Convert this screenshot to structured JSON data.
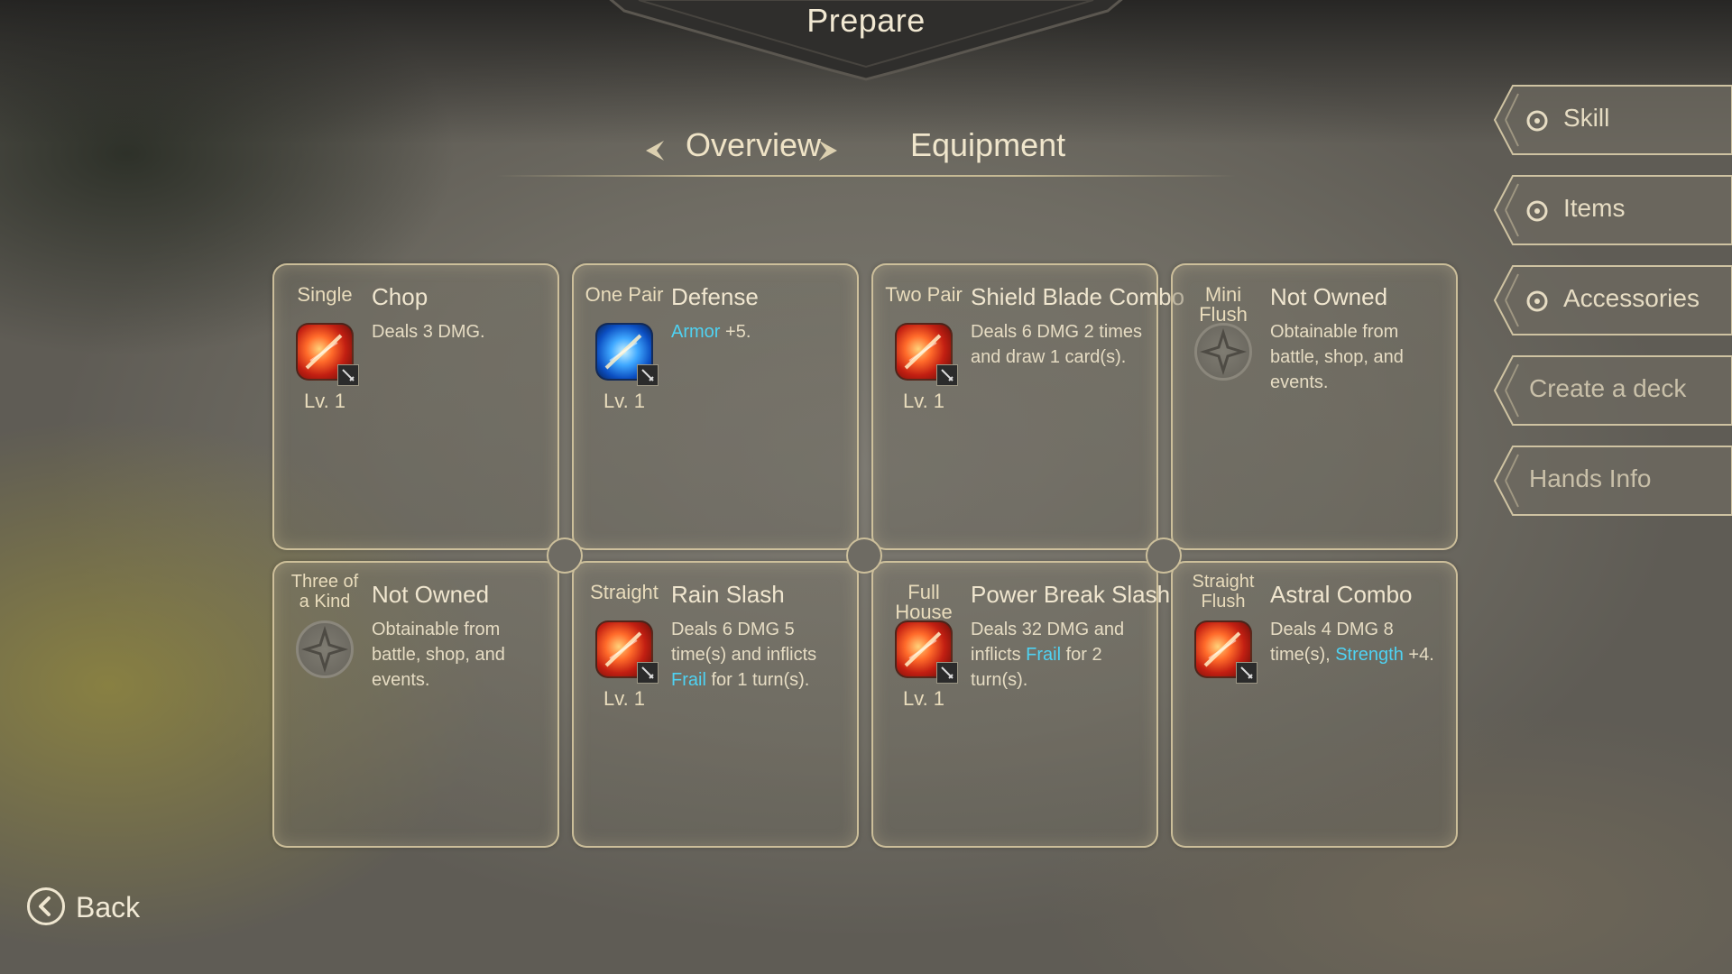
{
  "header": {
    "title": "Prepare"
  },
  "tabs": {
    "overview": "Overview",
    "equipment": "Equipment"
  },
  "cards": [
    {
      "hand": "Single",
      "name": "Chop",
      "level": "Lv. 1",
      "icon": "flame-slash-icon",
      "owned": true,
      "desc": [
        {
          "t": "Deals 3 DMG."
        }
      ]
    },
    {
      "hand": "One Pair",
      "name": "Defense",
      "level": "Lv. 1",
      "icon": "blue-shield-icon",
      "owned": true,
      "desc": [
        {
          "t": "Armor",
          "kw": true
        },
        {
          "t": " +5."
        }
      ]
    },
    {
      "hand": "Two Pair",
      "name": "Shield Blade Combo",
      "level": "Lv. 1",
      "icon": "shield-blade-icon",
      "owned": true,
      "desc": [
        {
          "t": "Deals 6 DMG 2 times and draw 1 card(s)."
        }
      ]
    },
    {
      "hand": "Mini Flush",
      "name": "Not Owned",
      "level": "",
      "icon": "locked-star-icon",
      "owned": false,
      "desc": [
        {
          "t": "Obtainable from battle, shop, and events."
        }
      ]
    },
    {
      "hand": "Three of a Kind",
      "name": "Not Owned",
      "level": "",
      "icon": "locked-star-icon",
      "owned": false,
      "desc": [
        {
          "t": "Obtainable from battle, shop, and events."
        }
      ]
    },
    {
      "hand": "Straight",
      "name": "Rain Slash",
      "level": "Lv. 1",
      "icon": "rain-slash-icon",
      "owned": true,
      "desc": [
        {
          "t": "Deals 6 DMG 5 time(s) and inflicts "
        },
        {
          "t": "Frail",
          "kw": true
        },
        {
          "t": " for 1 turn(s)."
        }
      ]
    },
    {
      "hand": "Full House",
      "name": "Power Break Slash",
      "level": "Lv. 1",
      "icon": "power-break-icon",
      "owned": true,
      "desc": [
        {
          "t": "Deals 32 DMG and inflicts "
        },
        {
          "t": "Frail",
          "kw": true
        },
        {
          "t": " for 2 turn(s)."
        }
      ]
    },
    {
      "hand": "Straight Flush",
      "name": "Astral Combo",
      "level": "",
      "icon": "astral-claw-icon",
      "owned": true,
      "desc": [
        {
          "t": "Deals 4 DMG 8 time(s), "
        },
        {
          "t": "Strength",
          "kw": true
        },
        {
          "t": " +4."
        }
      ]
    }
  ],
  "side_menu": [
    {
      "label": "Skill",
      "icon": "skill-icon"
    },
    {
      "label": "Items",
      "icon": "pouch-icon"
    },
    {
      "label": "Accessories",
      "icon": "ring-icon"
    },
    {
      "label": "Create a deck",
      "icon": ""
    },
    {
      "label": "Hands Info",
      "icon": ""
    }
  ],
  "back": {
    "label": "Back"
  },
  "colors": {
    "keyword": "#4fd2f2",
    "frame": "#ddcea4",
    "text": "#e9dcbc"
  }
}
